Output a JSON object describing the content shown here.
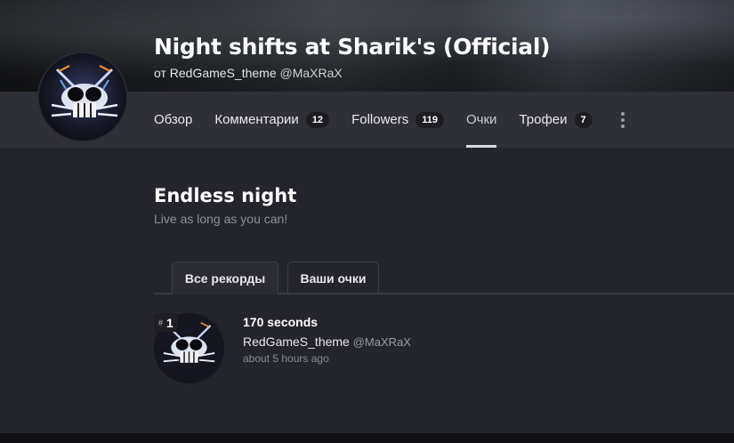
{
  "game": {
    "title": "Night shifts at Sharik's (Official)",
    "byline_prefix": "от RedGameS_theme",
    "byline_handle": "@MaXRaX"
  },
  "nav": {
    "tabs": [
      {
        "label": "Обзор"
      },
      {
        "label": "Комментарии",
        "count": "12"
      },
      {
        "label": "Followers",
        "count": "119"
      },
      {
        "label": "Очки",
        "active": true
      },
      {
        "label": "Трофеи",
        "count": "7"
      }
    ],
    "more_icon": "vertical-ellipsis-icon"
  },
  "leaderboard": {
    "title": "Endless night",
    "subtitle": "Live as long as you can!",
    "tabs": [
      {
        "label": "Все рекорды",
        "active": true
      },
      {
        "label": "Ваши очки"
      }
    ],
    "entries": [
      {
        "rank_symbol": "#",
        "rank": "1",
        "score": "170 seconds",
        "player": "RedGameS_theme",
        "handle": "@MaXRaX",
        "time": "about 5 hours ago"
      }
    ]
  },
  "colors": {
    "background": "#23232b",
    "navbar": "#2f2f38",
    "badge": "#1c1c22",
    "active_underline": "#d9d9e0"
  }
}
